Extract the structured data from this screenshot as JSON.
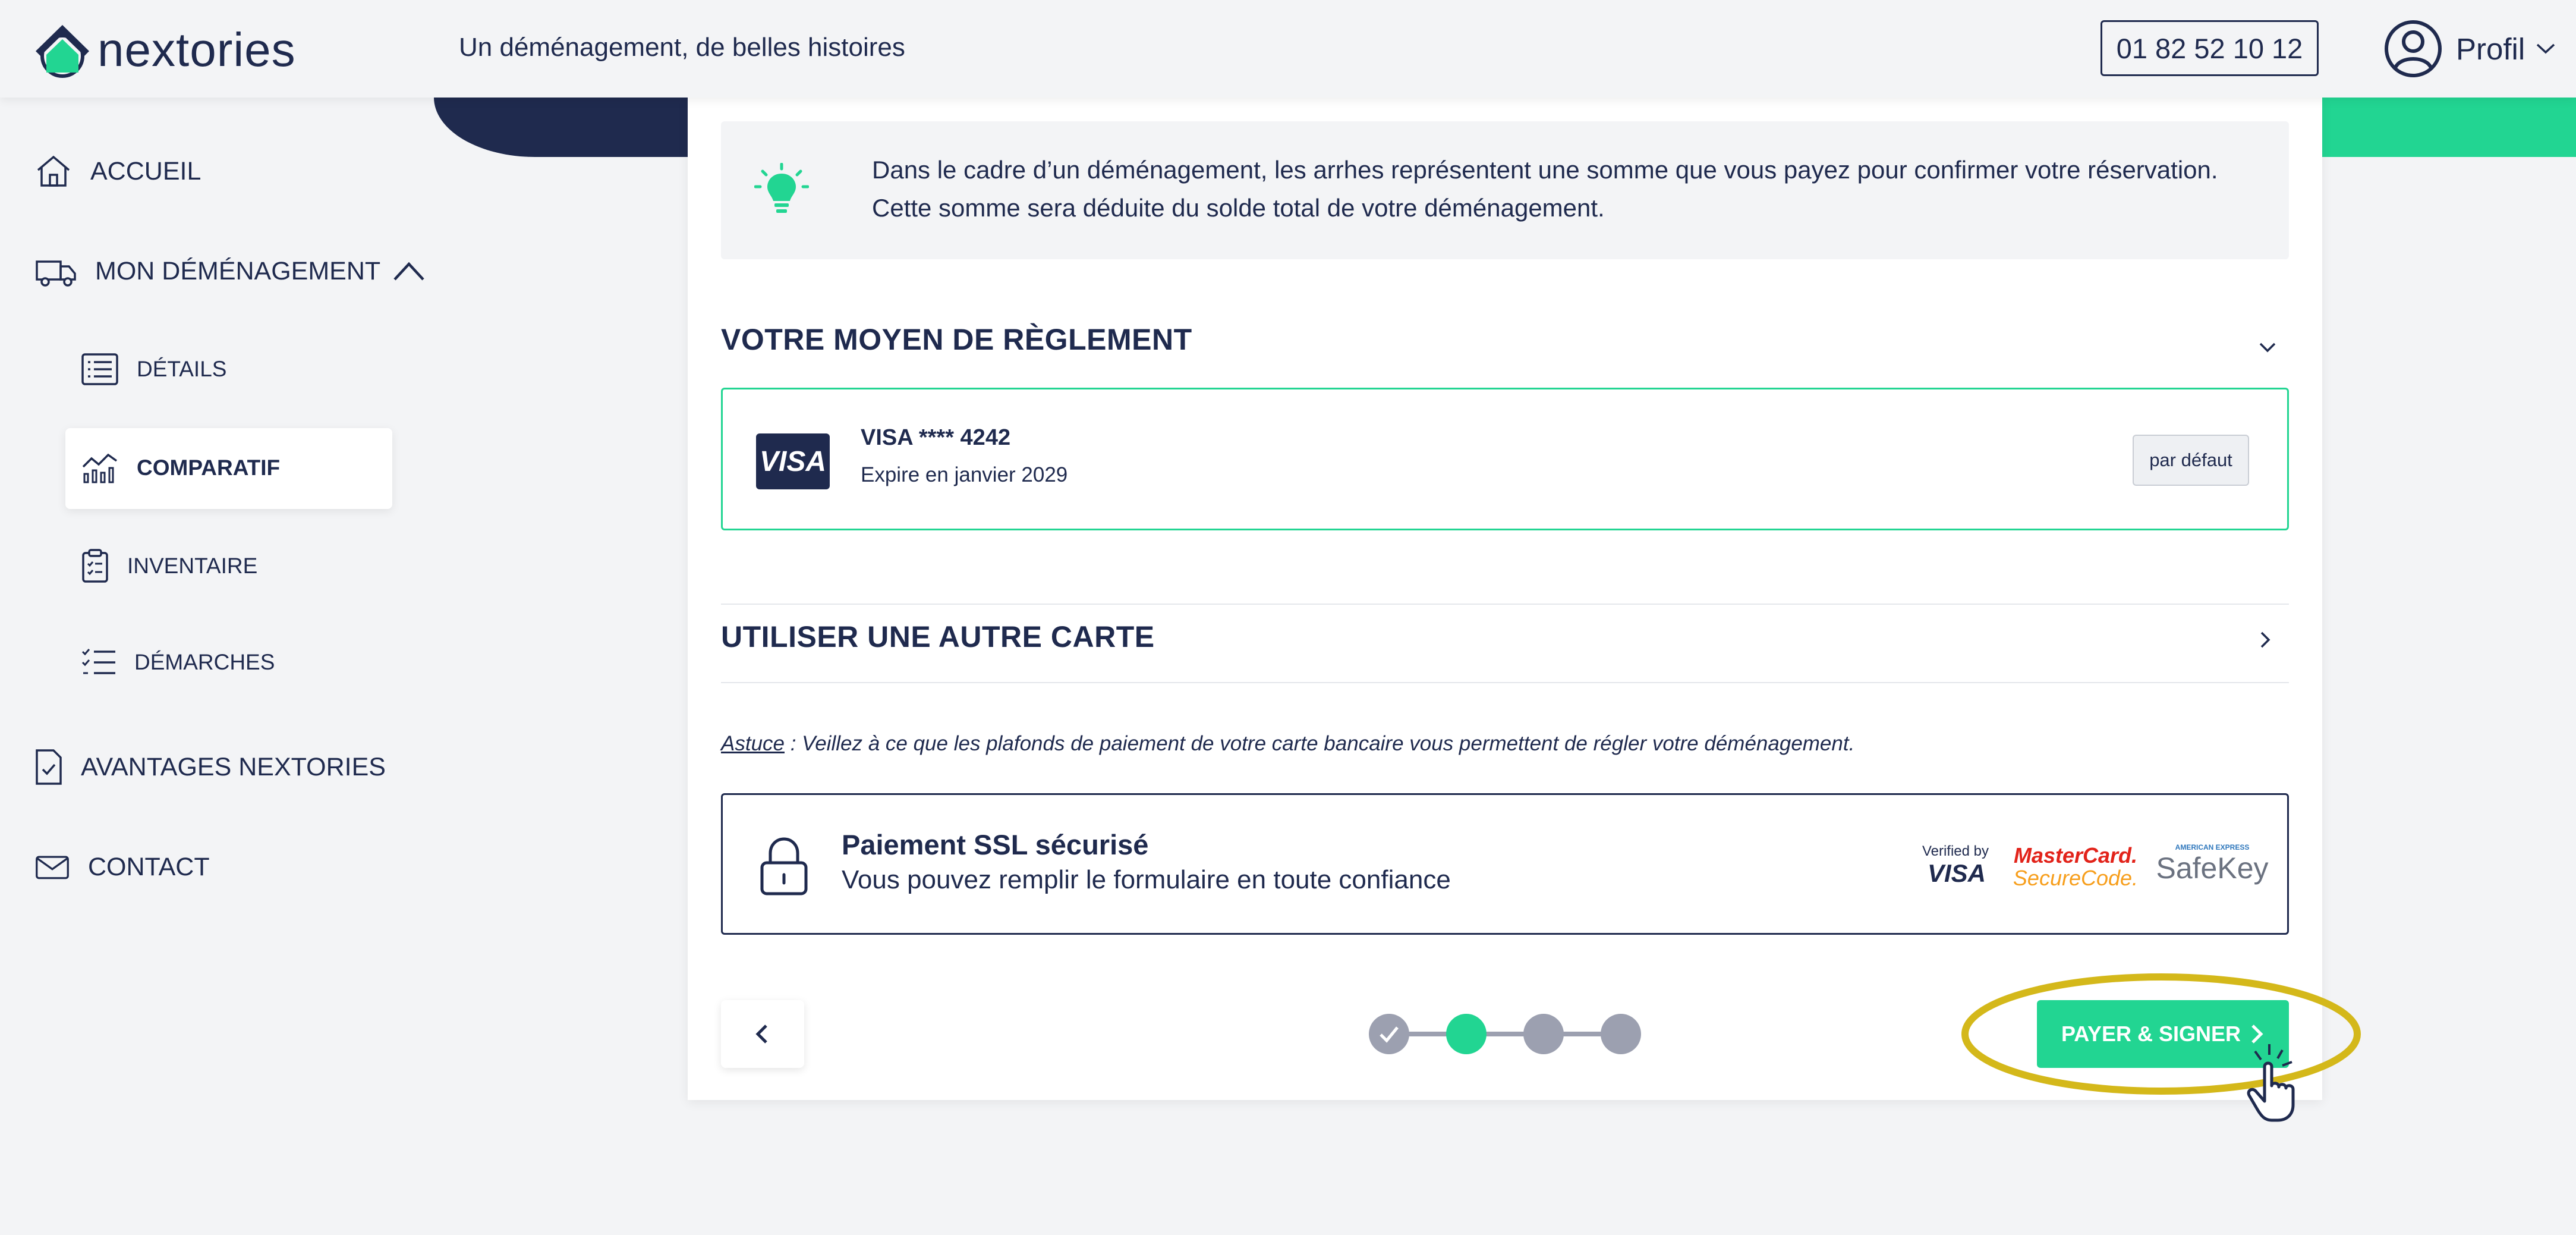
{
  "header": {
    "logo_text": "nextories",
    "tagline": "Un déménagement, de belles histoires",
    "phone": "01 82 52 10 12",
    "profile_label": "Profil"
  },
  "sidebar": {
    "items": [
      {
        "label": "ACCUEIL",
        "icon": "home-icon"
      },
      {
        "label": "MON DÉMÉNAGEMENT",
        "icon": "truck-icon",
        "expanded": true
      },
      {
        "label": "DÉTAILS",
        "icon": "list-icon"
      },
      {
        "label": "COMPARATIF",
        "icon": "chart-icon",
        "active": true
      },
      {
        "label": "INVENTAIRE",
        "icon": "clipboard-icon"
      },
      {
        "label": "DÉMARCHES",
        "icon": "checklist-icon"
      },
      {
        "label": "AVANTAGES NEXTORIES",
        "icon": "document-check-icon"
      },
      {
        "label": "CONTACT",
        "icon": "mail-icon"
      }
    ]
  },
  "info": {
    "line1": "Dans le cadre d’un déménagement, les arrhes représentent une somme que vous payez pour confirmer votre réservation.",
    "line2": "Cette somme sera déduite du solde total de votre déménagement."
  },
  "payment": {
    "section_title": "VOTRE MOYEN DE RÈGLEMENT",
    "card_brand": "VISA",
    "card_number": "VISA **** 4242",
    "card_expiry": "Expire en janvier 2029",
    "default_badge": "par défaut",
    "other_card_title": "UTILISER UNE AUTRE CARTE",
    "tip_label": "Astuce",
    "tip_text": " : Veillez à ce que les plafonds de paiement de votre carte bancaire vous permettent de régler votre déménagement."
  },
  "ssl": {
    "title": "Paiement SSL sécurisé",
    "subtitle": "Vous pouvez remplir le formulaire en toute confiance",
    "verified_by": "Verified by",
    "visa": "VISA",
    "mastercard": "MasterCard.",
    "securecode": "SecureCode.",
    "amex": "AMERICAN EXPRESS",
    "safekey": "SafeKey"
  },
  "footer": {
    "pay_button": "PAYER & SIGNER",
    "steps_total": 4,
    "current_step": 2
  },
  "colors": {
    "navy": "#1f2a4e",
    "green": "#22d592",
    "background": "#f3f4f6",
    "highlight": "#d4b81a"
  }
}
